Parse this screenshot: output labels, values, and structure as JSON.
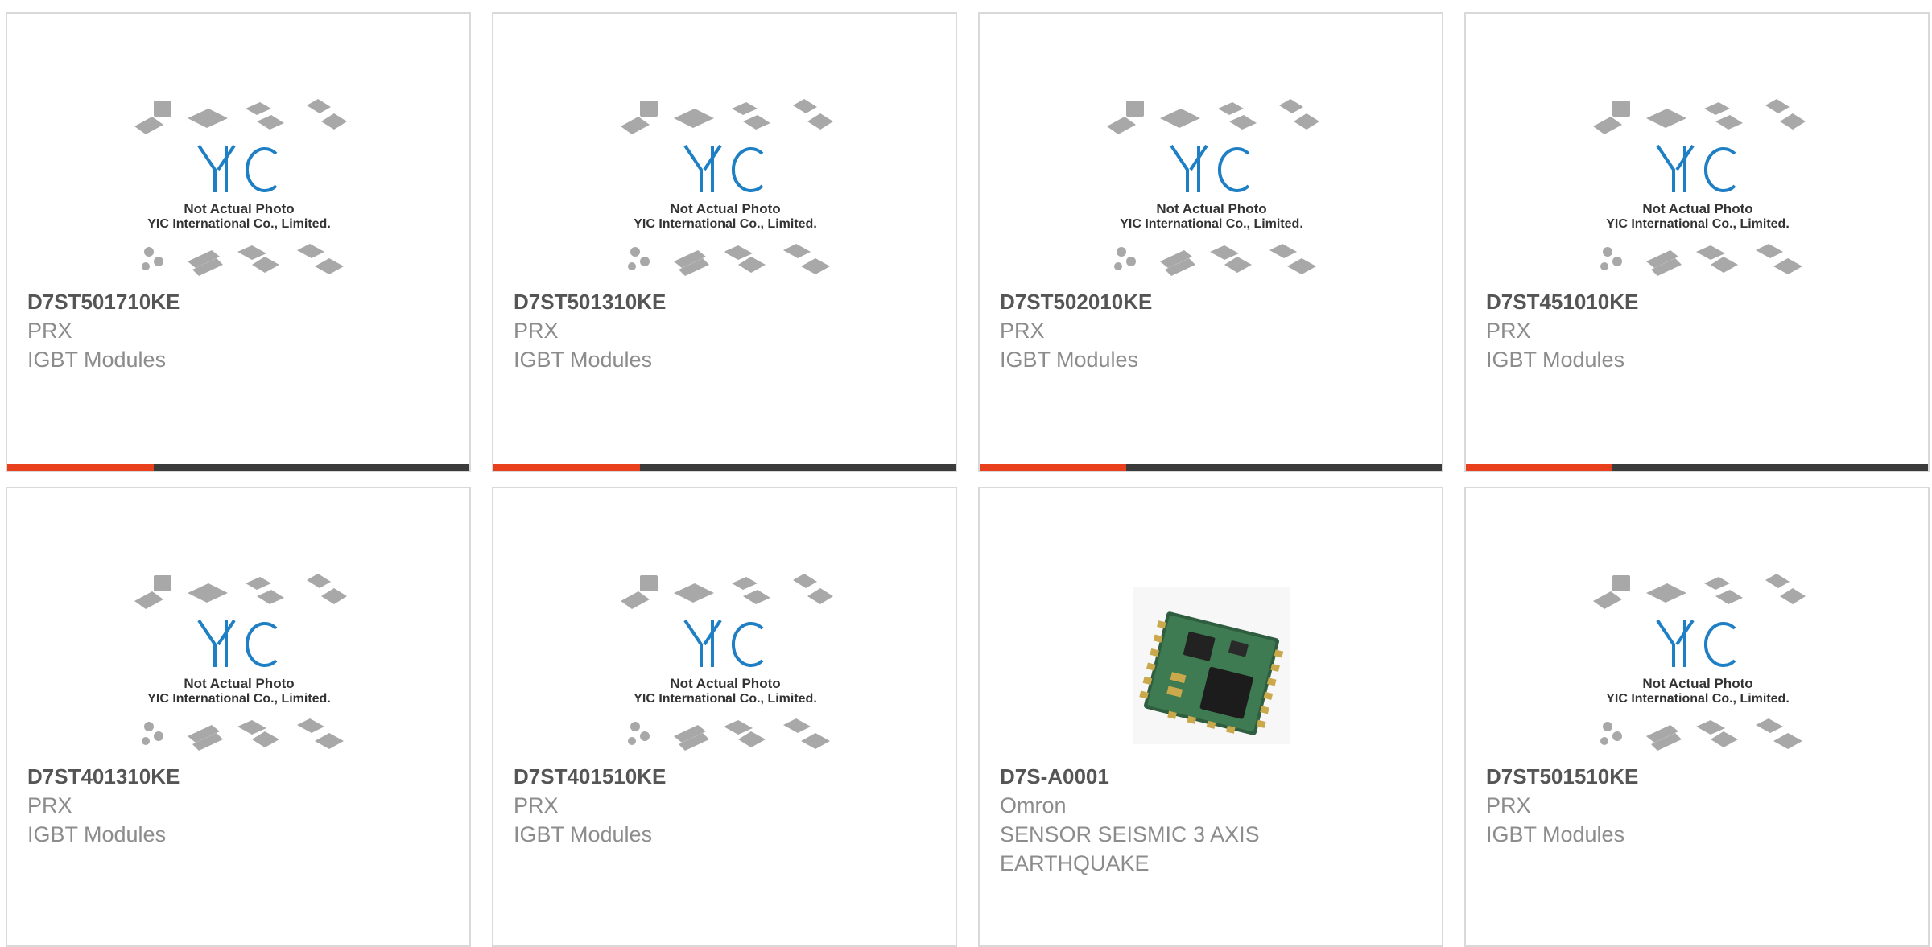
{
  "placeholder": {
    "line1": "Not Actual Photo",
    "line2": "YIC International Co., Limited.",
    "logo_text": "YIC"
  },
  "colors": {
    "accent": "#e8401c",
    "bar_dark": "#3b3b3b",
    "logo_blue": "#1f7fc4",
    "part_number": "#555555",
    "muted_text": "#8c8c8c"
  },
  "products": [
    {
      "part_number": "D7ST501710KE",
      "manufacturer": "PRX",
      "description": "IGBT Modules",
      "image": "placeholder",
      "show_bar": true
    },
    {
      "part_number": "D7ST501310KE",
      "manufacturer": "PRX",
      "description": "IGBT Modules",
      "image": "placeholder",
      "show_bar": true
    },
    {
      "part_number": "D7ST502010KE",
      "manufacturer": "PRX",
      "description": "IGBT Modules",
      "image": "placeholder",
      "show_bar": true
    },
    {
      "part_number": "D7ST451010KE",
      "manufacturer": "PRX",
      "description": "IGBT Modules",
      "image": "placeholder",
      "show_bar": true
    },
    {
      "part_number": "D7ST401310KE",
      "manufacturer": "PRX",
      "description": "IGBT Modules",
      "image": "placeholder",
      "show_bar": false
    },
    {
      "part_number": "D7ST401510KE",
      "manufacturer": "PRX",
      "description": "IGBT Modules",
      "image": "placeholder",
      "show_bar": false
    },
    {
      "part_number": "D7S-A0001",
      "manufacturer": "Omron",
      "description": "SENSOR SEISMIC 3 AXIS EARTHQUAKE",
      "image": "sensor-module-photo",
      "show_bar": false
    },
    {
      "part_number": "D7ST501510KE",
      "manufacturer": "PRX",
      "description": "IGBT Modules",
      "image": "placeholder",
      "show_bar": false
    }
  ]
}
